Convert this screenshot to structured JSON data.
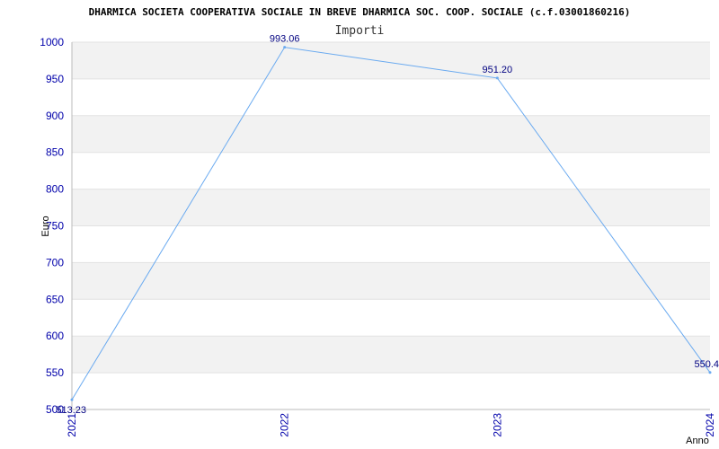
{
  "chart_data": {
    "type": "line",
    "title": "DHARMICA SOCIETA COOPERATIVA SOCIALE IN BREVE DHARMICA SOC. COOP. SOCIALE (c.f.03001860216)",
    "subtitle": "Importi",
    "xlabel": "Anno",
    "ylabel": "Euro",
    "categories": [
      "2021",
      "2022",
      "2023",
      "2024"
    ],
    "values": [
      513.23,
      993.06,
      951.2,
      550.4
    ],
    "data_labels": [
      "513.23",
      "993.06",
      "951.20",
      "550.4"
    ],
    "ylim": [
      500,
      1000
    ],
    "yticks": [
      "500",
      "550",
      "600",
      "650",
      "700",
      "750",
      "800",
      "850",
      "900",
      "950",
      "1000"
    ],
    "grid": true,
    "legend": "none",
    "colors": {
      "line": "#6aaaf0",
      "band": "#f2f2f2",
      "tick_text": "#0000aa",
      "label_text": "#000080"
    }
  }
}
